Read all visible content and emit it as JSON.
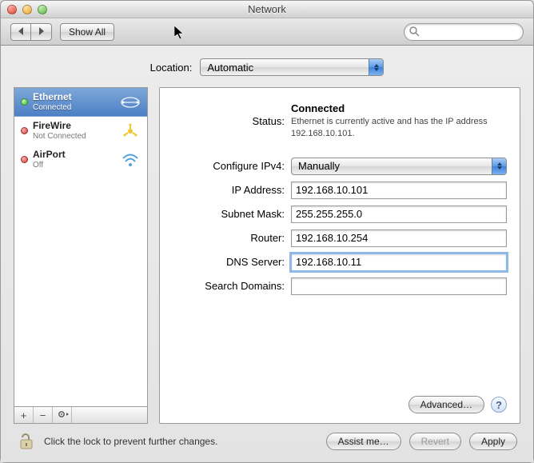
{
  "window": {
    "title": "Network"
  },
  "toolbar": {
    "show_all": "Show All",
    "search_placeholder": ""
  },
  "location": {
    "label": "Location:",
    "value": "Automatic"
  },
  "sidebar": {
    "items": [
      {
        "name": "Ethernet",
        "sub": "Connected",
        "status": "green",
        "icon": "ethernet",
        "selected": true
      },
      {
        "name": "FireWire",
        "sub": "Not Connected",
        "status": "red",
        "icon": "firewire",
        "selected": false
      },
      {
        "name": "AirPort",
        "sub": "Off",
        "status": "red",
        "icon": "airport",
        "selected": false
      }
    ]
  },
  "detail": {
    "status_label": "Status:",
    "status_value": "Connected",
    "status_desc": "Ethernet is currently active and has the IP address 192.168.10.101.",
    "configure_label": "Configure IPv4:",
    "configure_value": "Manually",
    "fields": {
      "ip": {
        "label": "IP Address:",
        "value": "192.168.10.101"
      },
      "subnet": {
        "label": "Subnet Mask:",
        "value": "255.255.255.0"
      },
      "router": {
        "label": "Router:",
        "value": "192.168.10.254"
      },
      "dns": {
        "label": "DNS Server:",
        "value": "192.168.10.11"
      },
      "search": {
        "label": "Search Domains:",
        "value": ""
      }
    },
    "advanced": "Advanced…"
  },
  "footer": {
    "lock_text": "Click the lock to prevent further changes.",
    "assist": "Assist me…",
    "revert": "Revert",
    "apply": "Apply"
  }
}
